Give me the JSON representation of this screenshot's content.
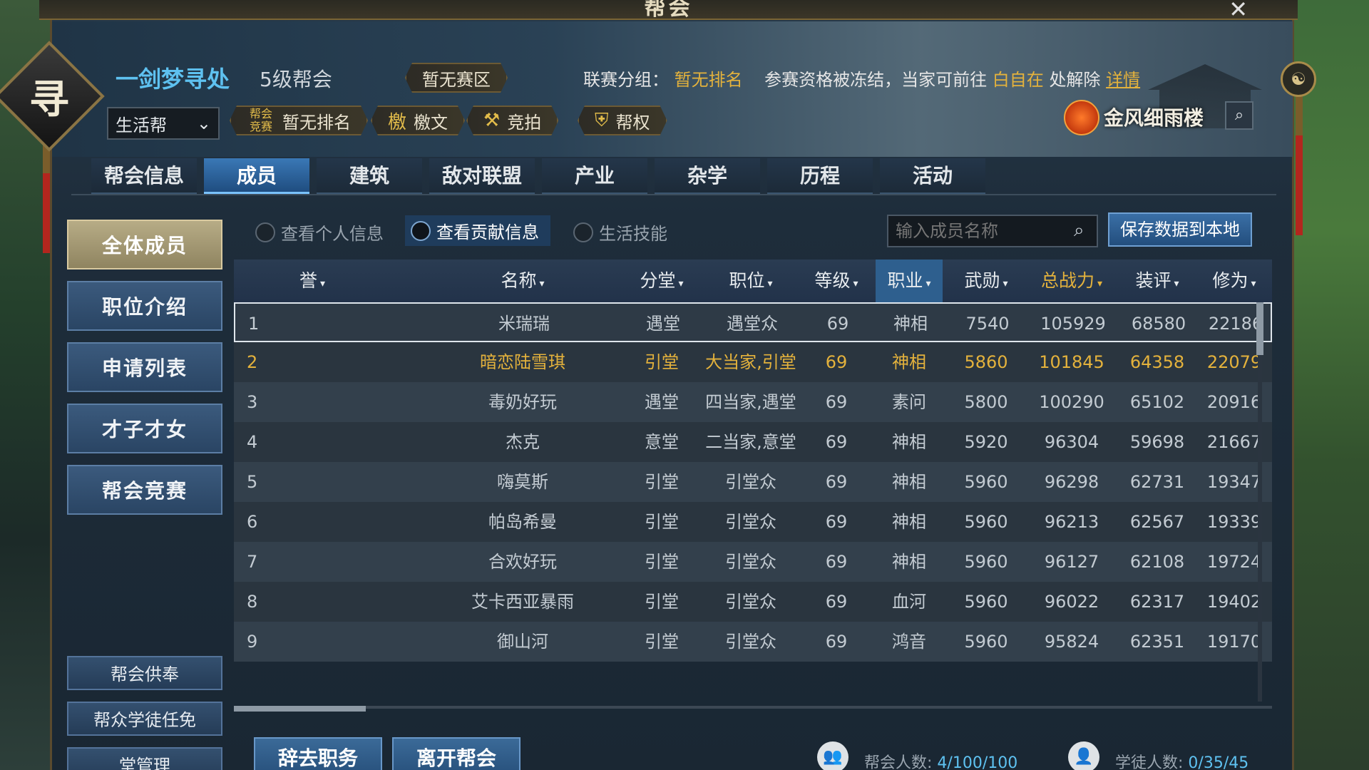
{
  "window": {
    "title": "帮会",
    "close_icon": "close-icon"
  },
  "guild": {
    "name": "一剑梦寻处",
    "level": "5级帮会",
    "emblem_char": "寻",
    "branch_select": "生活帮",
    "region": "暂无赛区",
    "rank_badge": "帮会竞赛",
    "rank": "暂无排名",
    "chips": [
      "檄文",
      "竞拍",
      "帮权"
    ]
  },
  "league": {
    "label": "联赛分组：",
    "group": "暂无排名",
    "notice_pre": "参赛资格被冻结，当家可前往",
    "place": "白自在",
    "notice_post": "处解除",
    "detail": "详情"
  },
  "house": {
    "name": "金风细雨楼"
  },
  "tabs": [
    "帮会信息",
    "成员",
    "建筑",
    "敌对联盟",
    "产业",
    "杂学",
    "历程",
    "活动"
  ],
  "active_tab": "成员",
  "side_menu": [
    "全体成员",
    "职位介绍",
    "申请列表",
    "才子才女",
    "帮会竞赛"
  ],
  "side_small": [
    "帮会供奉",
    "帮众学徒任免",
    "堂管理"
  ],
  "view_options": [
    "查看个人信息",
    "查看贡献信息",
    "生活技能"
  ],
  "search": {
    "placeholder": "输入成员名称"
  },
  "save_button": "保存数据到本地",
  "table": {
    "headers": [
      "誉",
      "名称",
      "分堂",
      "职位",
      "等级",
      "职业",
      "武勋",
      "总战力",
      "装评",
      "修为"
    ],
    "rows": [
      {
        "idx": "1",
        "name": "米瑞瑞",
        "hall": "遇堂",
        "position": "遇堂众",
        "level": "69",
        "class": "神相",
        "honor": "7540",
        "power": "105929",
        "gear": "68580",
        "cultivation": "22186"
      },
      {
        "idx": "2",
        "name": "暗恋陆雪琪",
        "hall": "引堂",
        "position": "大当家,引堂",
        "level": "69",
        "class": "神相",
        "honor": "5860",
        "power": "101845",
        "gear": "64358",
        "cultivation": "22079"
      },
      {
        "idx": "3",
        "name": "毒奶好玩",
        "hall": "遇堂",
        "position": "四当家,遇堂",
        "level": "69",
        "class": "素问",
        "honor": "5800",
        "power": "100290",
        "gear": "65102",
        "cultivation": "20916"
      },
      {
        "idx": "4",
        "name": "杰克",
        "hall": "意堂",
        "position": "二当家,意堂",
        "level": "69",
        "class": "神相",
        "honor": "5920",
        "power": "96304",
        "gear": "59698",
        "cultivation": "21667"
      },
      {
        "idx": "5",
        "name": "嗨莫斯",
        "hall": "引堂",
        "position": "引堂众",
        "level": "69",
        "class": "神相",
        "honor": "5960",
        "power": "96298",
        "gear": "62731",
        "cultivation": "19347"
      },
      {
        "idx": "6",
        "name": "帕岛希曼",
        "hall": "引堂",
        "position": "引堂众",
        "level": "69",
        "class": "神相",
        "honor": "5960",
        "power": "96213",
        "gear": "62567",
        "cultivation": "19339"
      },
      {
        "idx": "7",
        "name": "合欢好玩",
        "hall": "引堂",
        "position": "引堂众",
        "level": "69",
        "class": "神相",
        "honor": "5960",
        "power": "96127",
        "gear": "62108",
        "cultivation": "19724"
      },
      {
        "idx": "8",
        "name": "艾卡西亚暴雨",
        "hall": "引堂",
        "position": "引堂众",
        "level": "69",
        "class": "血河",
        "honor": "5960",
        "power": "96022",
        "gear": "62317",
        "cultivation": "19402"
      },
      {
        "idx": "9",
        "name": "御山河",
        "hall": "引堂",
        "position": "引堂众",
        "level": "69",
        "class": "鸿音",
        "honor": "5960",
        "power": "95824",
        "gear": "62351",
        "cultivation": "19170"
      }
    ]
  },
  "bottom": {
    "resign": "辞去职务",
    "leave": "离开帮会",
    "members_label": "帮会人数:",
    "members_value": "4/100/100",
    "apprentice_label": "学徒人数:",
    "apprentice_value": "0/35/45"
  },
  "colors": {
    "accent": "#5ec1f0",
    "gold": "#e4b23c",
    "active_tab": "#3a78b6"
  }
}
